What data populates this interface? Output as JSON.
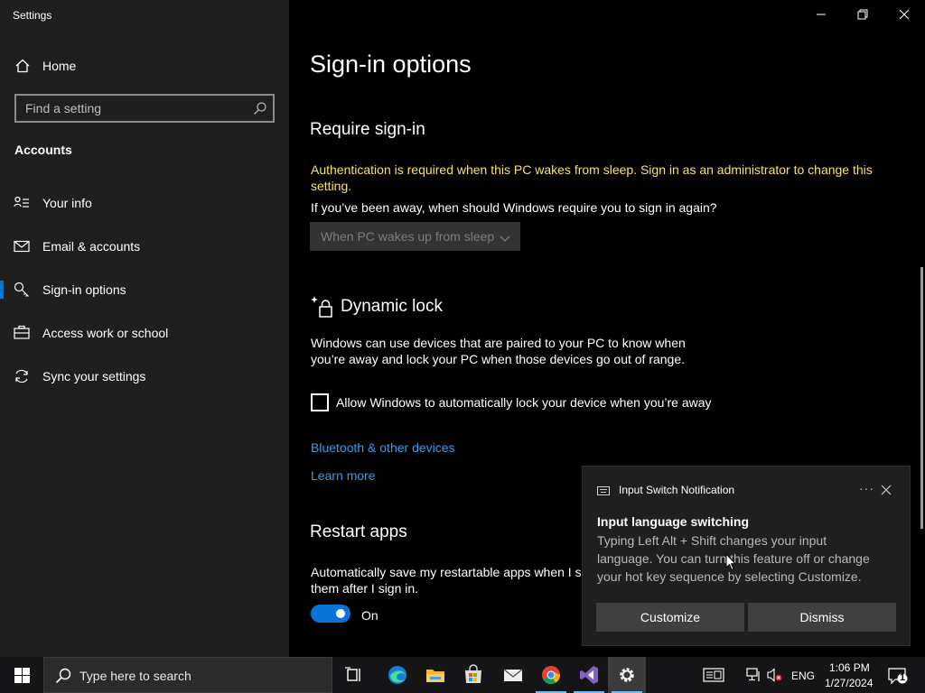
{
  "window": {
    "app_title": "Settings",
    "controls": [
      "minimize-icon",
      "restore-icon",
      "close-icon"
    ]
  },
  "sidebar": {
    "home_label": "Home",
    "search_placeholder": "Find a setting",
    "section_heading": "Accounts",
    "items": [
      {
        "label": "Your info",
        "icon": "person-card-icon",
        "active": false
      },
      {
        "label": "Email & accounts",
        "icon": "mail-icon",
        "active": false
      },
      {
        "label": "Sign-in options",
        "icon": "key-icon",
        "active": true
      },
      {
        "label": "Access work or school",
        "icon": "briefcase-icon",
        "active": false
      },
      {
        "label": "Sync your settings",
        "icon": "sync-icon",
        "active": false
      }
    ]
  },
  "main": {
    "page_title": "Sign-in options",
    "require_signin": {
      "heading": "Require sign-in",
      "warning_line1": "Authentication is required when this PC wakes from sleep. Sign in as an administrator to change this",
      "warning_line2": "setting.",
      "question": "If you’ve been away, when should Windows require you to sign in again?",
      "dropdown_value": "When PC wakes up from sleep"
    },
    "dynamic_lock": {
      "heading": "Dynamic lock",
      "description_line1": "Windows can use devices that are paired to your PC to know when",
      "description_line2": "you’re away and lock your PC when those devices go out of range.",
      "checkbox_label": "Allow Windows to automatically lock your device when you’re away",
      "checkbox_checked": false,
      "link_bluetooth": "Bluetooth & other devices",
      "link_learn_more": "Learn more"
    },
    "restart_apps": {
      "heading": "Restart apps",
      "description_line1": "Automatically save my restartable apps when I si",
      "description_line2": "them after I sign in.",
      "toggle_state": "On",
      "toggle_on": true
    }
  },
  "toast": {
    "app_name": "Input Switch Notification",
    "more_label": "···",
    "title": "Input language switching",
    "body_line1": "Typing Left Alt + Shift changes your input",
    "body_line2": "language. You can turn this feature off or change",
    "body_line3": "your hot key sequence by selecting Customize.",
    "buttons": {
      "customize": "Customize",
      "dismiss": "Dismiss"
    }
  },
  "taskbar": {
    "search_placeholder": "Type here to search",
    "apps": [
      "task-view-icon",
      "edge-icon",
      "file-explorer-icon",
      "store-icon",
      "mail-icon",
      "chrome-icon",
      "visual-studio-icon",
      "settings-gear-icon"
    ],
    "tray": {
      "language": "ENG",
      "time": "1:06 PM",
      "date": "1/27/2024",
      "notification_count": "1"
    }
  },
  "colors": {
    "accent": "#0078d7",
    "warning_text": "#f7e467",
    "link": "#3c9be8",
    "sidebar_bg": "#1f1f1f",
    "content_bg": "#000000",
    "toggle_on": "#0a74d6"
  }
}
